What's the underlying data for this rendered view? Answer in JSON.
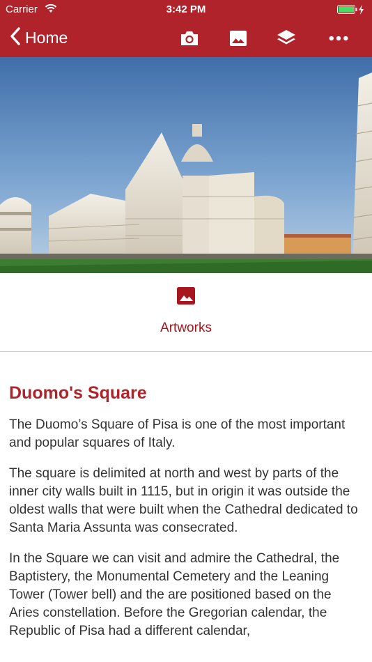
{
  "status_bar": {
    "carrier": "Carrier",
    "time": "3:42 PM"
  },
  "nav": {
    "back_label": "Home",
    "icons": [
      "camera-icon",
      "image-icon",
      "layers-icon",
      "more-icon"
    ]
  },
  "colors": {
    "brand": "#b0232b",
    "text": "#333333"
  },
  "section": {
    "label": "Artworks",
    "icon": "image-icon"
  },
  "article": {
    "title": "Duomo's Square",
    "paragraphs": [
      "The Duomo’s Square of Pisa is one of the most important and popular squares of Italy.",
      "The square is delimited at north and west by parts of the inner city walls built in 1115, but in origin it was outside the oldest walls that were built when the Cathedral dedicated to Santa Maria Assunta was consecrated.",
      "In the Square we can visit and admire the Cathedral, the Baptistery, the Monumental Cemetery and the Leaning Tower (Tower bell) and the are positioned based on the Aries constellation.  Before the Gregorian calendar, the Republic of Pisa had a different calendar,"
    ]
  }
}
